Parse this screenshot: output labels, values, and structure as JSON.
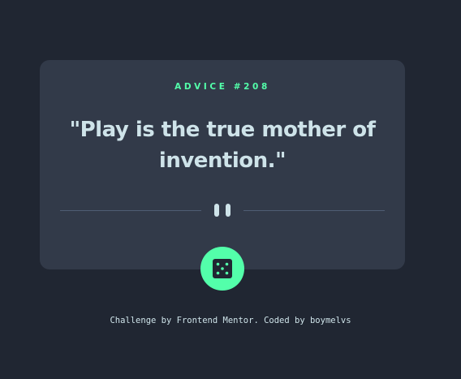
{
  "advice": {
    "id_label": "ADVICE #208",
    "quote": "\"Play is the true mother of invention.\""
  },
  "dice_button": {
    "icon": "dice-icon"
  },
  "footer": {
    "text": "Challenge by Frontend Mentor. Coded by boymelvs"
  },
  "colors": {
    "background": "#202632",
    "card": "#323a49",
    "accent": "#53ffaa",
    "text": "#cee3e9",
    "divider": "#4f5d74"
  }
}
